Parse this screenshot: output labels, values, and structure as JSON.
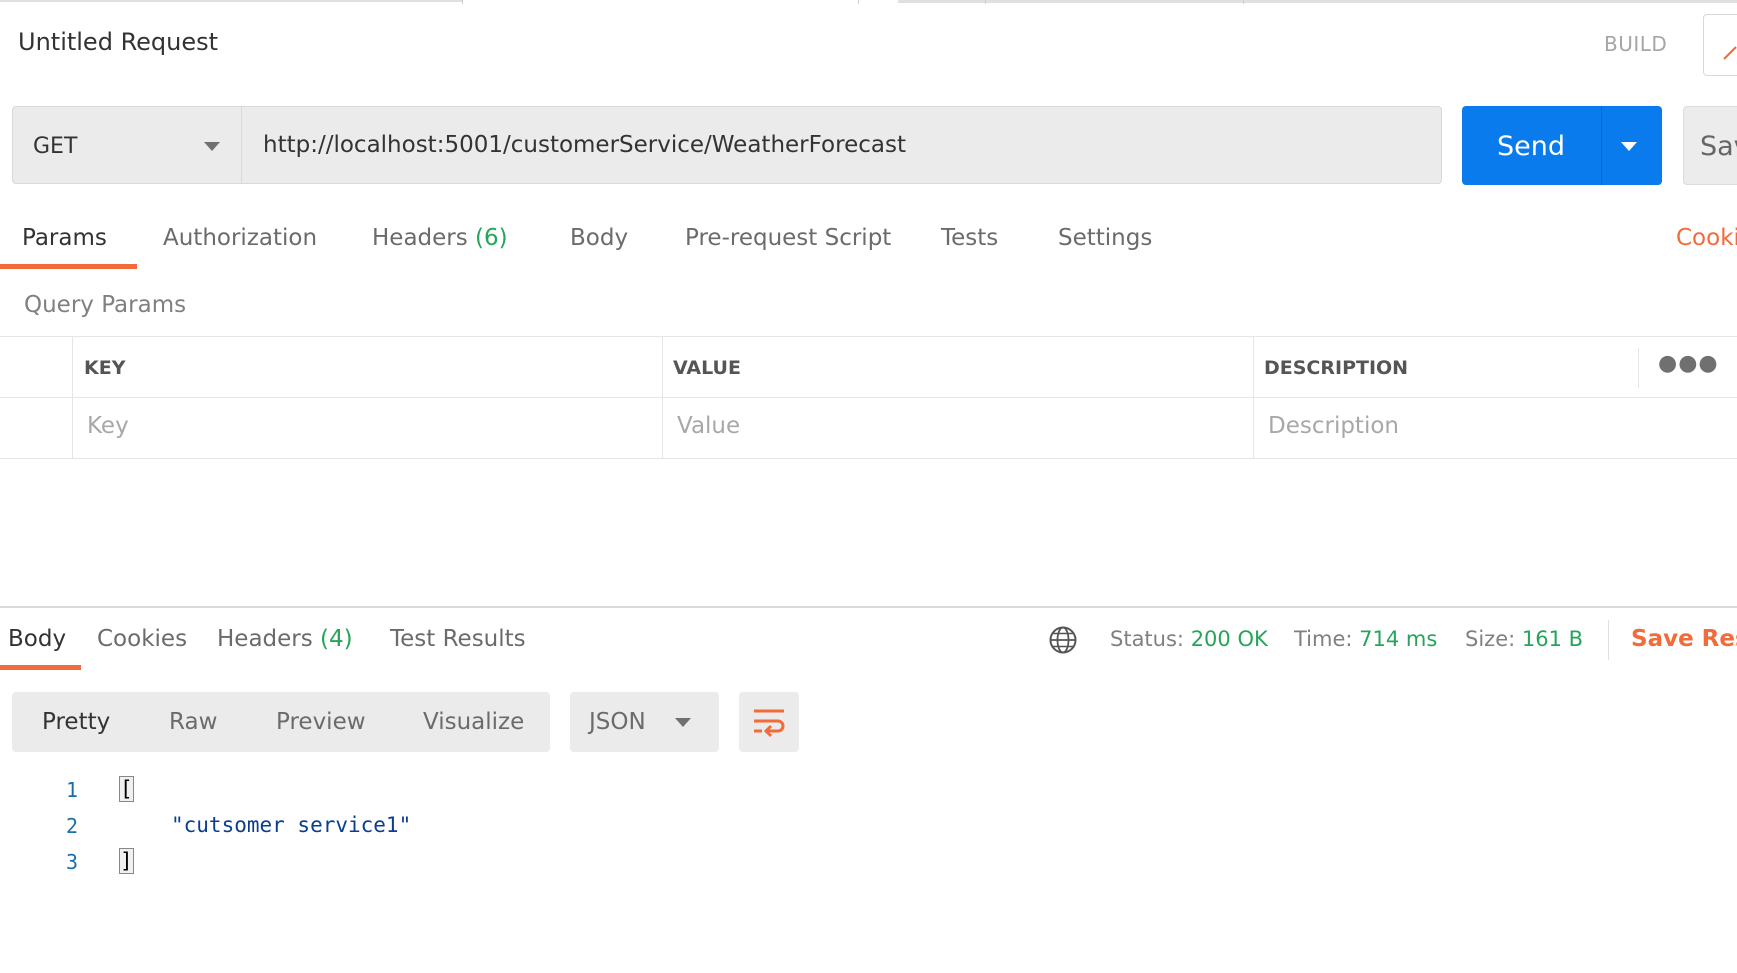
{
  "request": {
    "title": "Untitled Request",
    "mode_label": "BUILD",
    "method": "GET",
    "url": "http://localhost:5001/customerService/WeatherForecast",
    "send_label": "Send",
    "save_label": "Sav"
  },
  "request_tabs": [
    {
      "label": "Params",
      "active": true
    },
    {
      "label": "Authorization"
    },
    {
      "label": "Headers",
      "count": "(6)"
    },
    {
      "label": "Body"
    },
    {
      "label": "Pre-request Script"
    },
    {
      "label": "Tests"
    },
    {
      "label": "Settings"
    }
  ],
  "cookies_link": "Cooki",
  "query_params": {
    "title": "Query Params",
    "columns": [
      "KEY",
      "VALUE",
      "DESCRIPTION"
    ],
    "placeholders": [
      "Key",
      "Value",
      "Description"
    ],
    "more_icon": "more-horizontal-icon"
  },
  "response_tabs": [
    {
      "label": "Body",
      "active": true
    },
    {
      "label": "Cookies"
    },
    {
      "label": "Headers",
      "count": "(4)"
    },
    {
      "label": "Test Results"
    }
  ],
  "status": {
    "status_key": "Status:",
    "status_val": "200 OK",
    "time_key": "Time:",
    "time_val": "714 ms",
    "size_key": "Size:",
    "size_val": "161 B",
    "save_response": "Save Resp",
    "globe_icon": "globe-icon"
  },
  "view": {
    "modes": [
      "Pretty",
      "Raw",
      "Preview",
      "Visualize"
    ],
    "format": "JSON",
    "wrap_icon": "wrap-lines-icon"
  },
  "code_lines": [
    {
      "n": "1",
      "text": "["
    },
    {
      "n": "2",
      "text": "\"cutsomer service1\""
    },
    {
      "n": "3",
      "text": "]"
    }
  ],
  "colors": {
    "accent_orange": "#f26b3a",
    "send_blue": "#097bed",
    "success_green": "#26a55a"
  }
}
